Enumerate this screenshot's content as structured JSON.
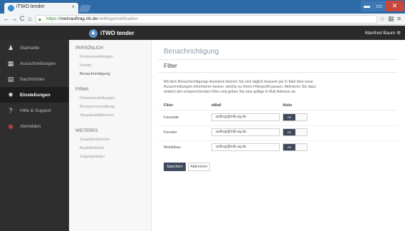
{
  "browser": {
    "tab_title": "iTWO tender",
    "tab_close": "×",
    "url_proto": "https://",
    "url_host": "meinauftrag.rib.de",
    "url_path": "/settings/notification",
    "icons": {
      "back": "back-icon",
      "forward": "forward-icon",
      "reload": "reload-icon",
      "home": "home-icon",
      "lock": "lock-icon",
      "star": "star-icon",
      "menu": "menu-icon"
    }
  },
  "window_controls": {
    "min": "▬",
    "max": "▭",
    "close": "✕"
  },
  "app": {
    "brand": "iTWO tender",
    "user": "Manfred Baum ⚙"
  },
  "leftnav": {
    "items": [
      {
        "label": "Startseite",
        "glyph": "♟"
      },
      {
        "label": "Ausschreibungen",
        "glyph": "▦"
      },
      {
        "label": "Nachrichten",
        "glyph": "▤"
      },
      {
        "label": "Einstellungen",
        "glyph": "✹"
      },
      {
        "label": "Hilfe & Support",
        "glyph": "?"
      },
      {
        "label": "Abmelden",
        "glyph": "◉"
      }
    ]
  },
  "subnav": {
    "sections": [
      {
        "title": "PERSÖNLICH",
        "items": [
          "Kontoeinstellungen",
          "Inhalte",
          "Benachrichtigung"
        ]
      },
      {
        "title": "FIRMA",
        "items": [
          "Firmeneinstellungen",
          "Benutzerverwaltung",
          "Vergabeplattformen"
        ]
      },
      {
        "title": "WEITERES",
        "items": [
          "Zusatzfunktionen",
          "Bestellhistorie",
          "Zugangsdaten"
        ]
      }
    ]
  },
  "main": {
    "title": "Benachrichtigung",
    "section": "Filter",
    "description": "Mit dem Benachrichtigungs-Assistent können Sie sich täglich bequem per E-Mail über neue Ausschreibungen informieren lassen, welche zu Ihrem Filterprofil passen. Aktivieren Sie dazu einfach den entsprechenden Filter und geben Sie eine gültige E-Mail Adresse an.",
    "columns": {
      "filter": "Filter",
      "email": "eMail",
      "active": "Aktiv"
    },
    "rows": [
      {
        "filter": "Fassade",
        "email": "auftrag@mtb-ag.de",
        "toggle": "An"
      },
      {
        "filter": "Fenster",
        "email": "auftrag@mtb-ag.de",
        "toggle": "An"
      },
      {
        "filter": "Metallbau",
        "email": "auftrag@mtb-ag.de",
        "toggle": "An"
      }
    ],
    "save": "Speichern",
    "cancel": "Abbrechen"
  }
}
